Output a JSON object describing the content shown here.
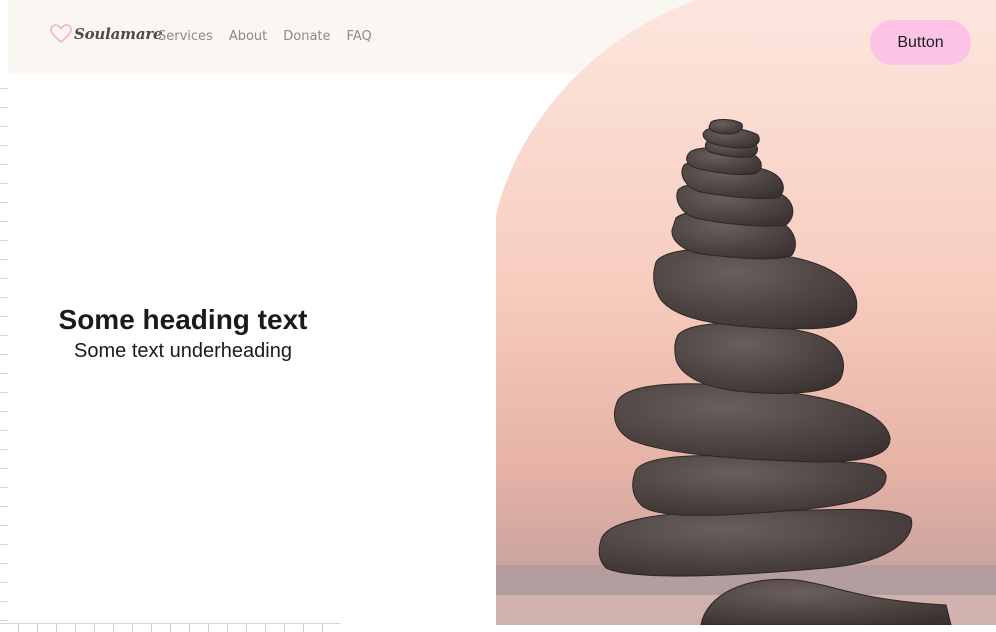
{
  "brand": {
    "name": "Soulamare",
    "heart_color": "#f6b7cf"
  },
  "nav": {
    "items": [
      {
        "label": "Services"
      },
      {
        "label": "About"
      },
      {
        "label": "Donate"
      },
      {
        "label": "FAQ"
      }
    ]
  },
  "header": {
    "cta_label": "Button",
    "cta_color": "#fdc3e6"
  },
  "hero": {
    "heading": "Some heading text",
    "subheading": "Some text underheading",
    "image_subject": "stacked-stones-at-sunset"
  },
  "colors": {
    "header_bg": "#faf7f3",
    "sky_top": "#fce2d8",
    "sky_bottom": "#d9a89c",
    "stone": "#4d4442"
  }
}
